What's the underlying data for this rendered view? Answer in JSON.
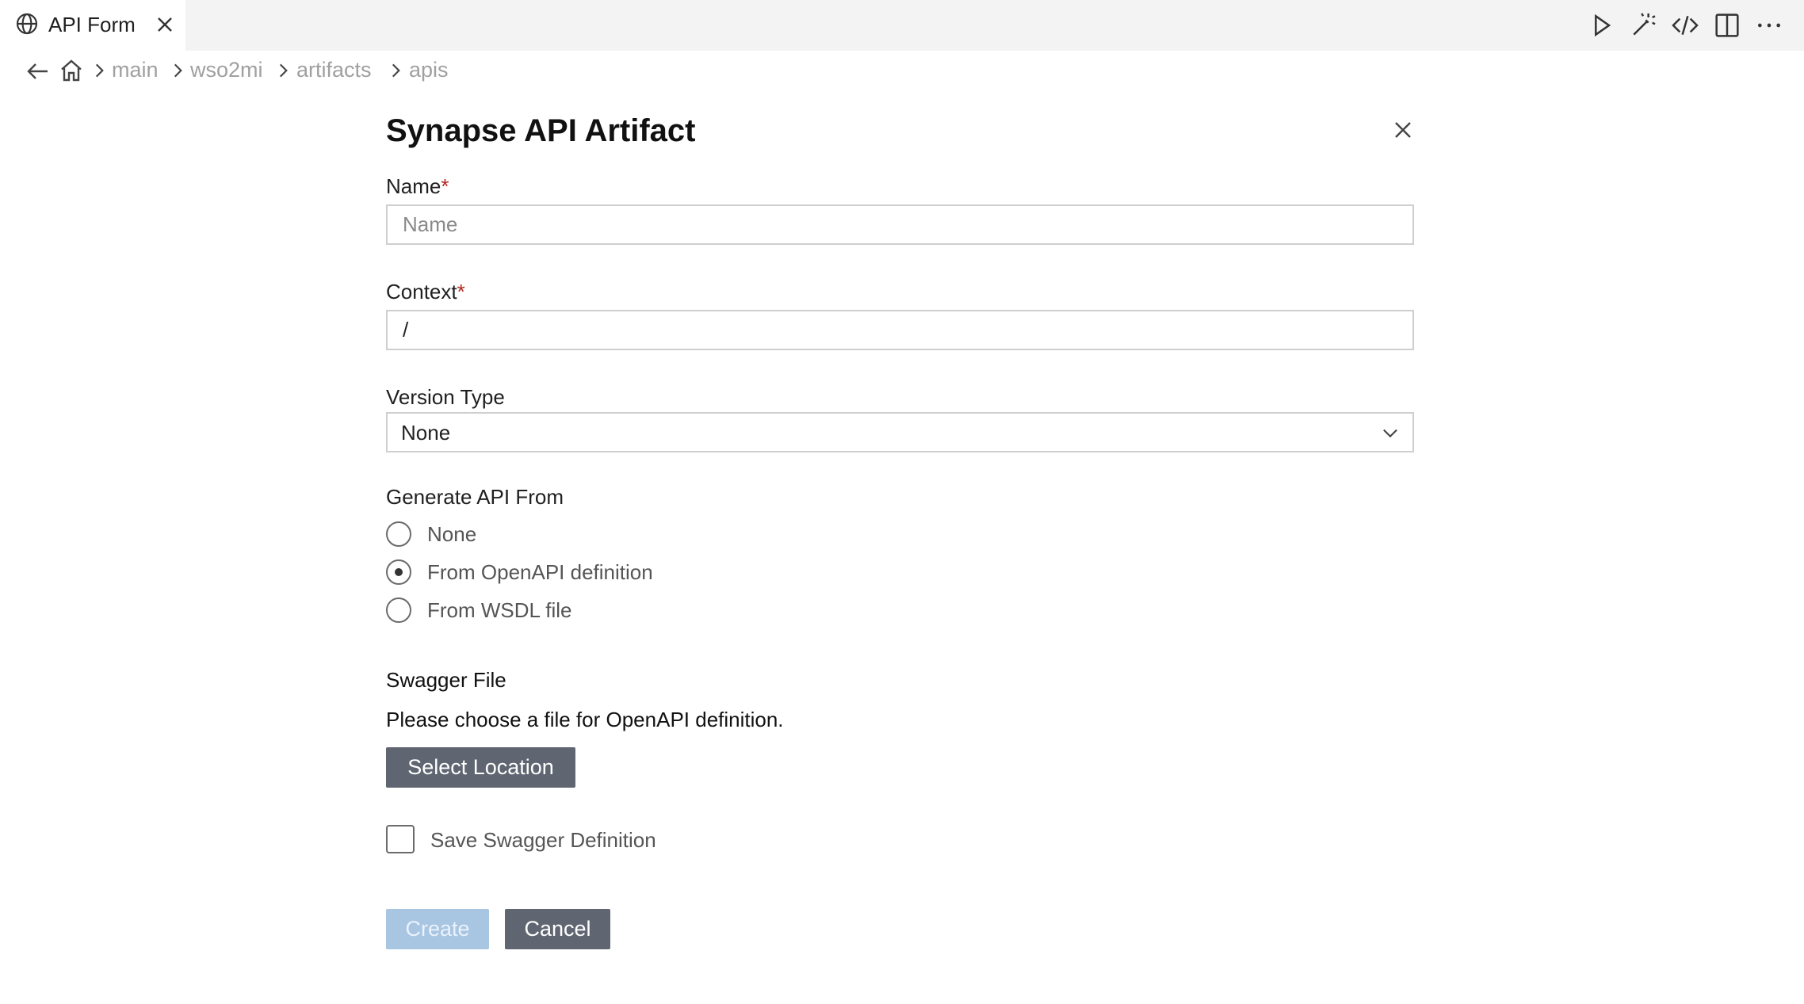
{
  "tab": {
    "title": "API Form",
    "globe_icon": "globe-icon",
    "close_icon": "close-icon"
  },
  "toolbar": {
    "icons": [
      "run-icon",
      "magic-wand-icon",
      "code-icon",
      "split-editor-icon",
      "more-icon"
    ]
  },
  "breadcrumb": {
    "back_icon": "arrow-left-icon",
    "home_icon": "home-icon",
    "items": [
      "main",
      "wso2mi",
      "artifacts",
      "apis"
    ]
  },
  "form": {
    "title": "Synapse API Artifact",
    "name": {
      "label": "Name",
      "required_mark": "*",
      "placeholder": "Name",
      "value": ""
    },
    "context": {
      "label": "Context",
      "required_mark": "*",
      "value": "/"
    },
    "version_type": {
      "label": "Version Type",
      "selected": "None"
    },
    "generate_from": {
      "label": "Generate API From",
      "options": [
        "None",
        "From OpenAPI definition",
        "From WSDL file"
      ],
      "selected": "From OpenAPI definition"
    },
    "swagger": {
      "label": "Swagger File",
      "description": "Please choose a file for OpenAPI definition.",
      "button": "Select Location"
    },
    "save_swagger": {
      "label": "Save Swagger Definition",
      "checked": false
    },
    "actions": {
      "create": "Create",
      "cancel": "Cancel"
    }
  },
  "colors": {
    "tabbar_bg": "#f3f3f3",
    "required": "#b3261e",
    "button_dark": "#5f6672",
    "button_disabled": "#a8c5e2"
  }
}
